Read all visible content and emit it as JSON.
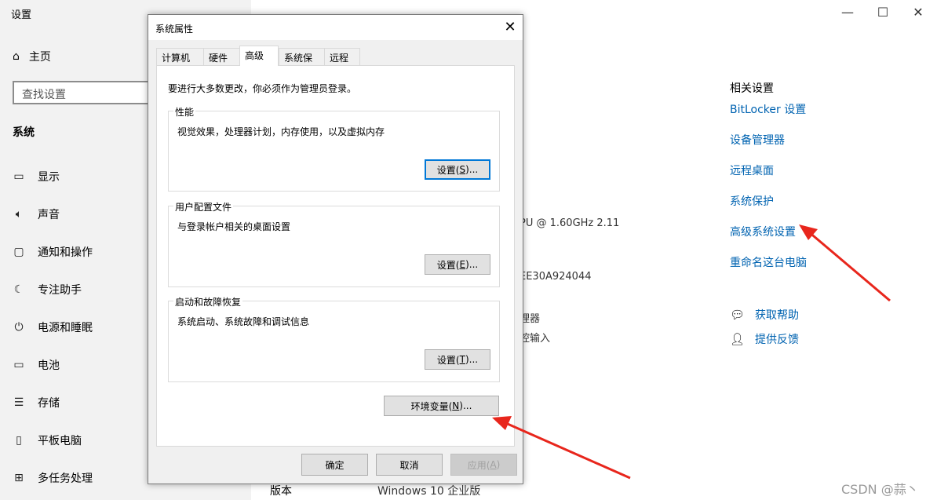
{
  "settings": {
    "window_title": "设置",
    "home_label": "主页",
    "search_placeholder": "查找设置",
    "section_title": "系统",
    "nav_items": [
      {
        "icon": "monitor-icon",
        "label": "显示"
      },
      {
        "icon": "speaker-icon",
        "label": "声音"
      },
      {
        "icon": "notification-icon",
        "label": "通知和操作"
      },
      {
        "icon": "moon-icon",
        "label": "专注助手"
      },
      {
        "icon": "power-icon",
        "label": "电源和睡眠"
      },
      {
        "icon": "battery-icon",
        "label": "电池"
      },
      {
        "icon": "storage-icon",
        "label": "存储"
      },
      {
        "icon": "tablet-icon",
        "label": "平板电脑"
      },
      {
        "icon": "multitask-icon",
        "label": "多任务处理"
      }
    ],
    "window_controls": {
      "minimize": "—",
      "maximize": "☐",
      "close": "✕"
    }
  },
  "background_info": {
    "cpu_partial": "PU @ 1.60GHz   2.11",
    "id_partial": "EE30A924044",
    "processor_partial": "理器",
    "input_partial": "控输入",
    "version_label": "版本",
    "version_value": "Windows 10 企业版"
  },
  "related": {
    "title": "相关设置",
    "links": [
      "BitLocker 设置",
      "设备管理器",
      "远程桌面",
      "系统保护",
      "高级系统设置",
      "重命名这台电脑"
    ],
    "help": [
      {
        "icon": "help-chat-icon",
        "label": "获取帮助"
      },
      {
        "icon": "feedback-icon",
        "label": "提供反馈"
      }
    ]
  },
  "dialog": {
    "title": "系统属性",
    "close": "✕",
    "tabs": [
      "计算机名",
      "硬件",
      "高级",
      "系统保护",
      "远程"
    ],
    "active_tab": "高级",
    "notice": "要进行大多数更改，你必须作为管理员登录。",
    "groups": [
      {
        "label": "性能",
        "desc": "视觉效果，处理器计划，内存使用，以及虚拟内存",
        "button_pre": "设置(",
        "button_key": "S",
        "button_post": ")..."
      },
      {
        "label": "用户配置文件",
        "desc": "与登录帐户相关的桌面设置",
        "button_pre": "设置(",
        "button_key": "E",
        "button_post": ")..."
      },
      {
        "label": "启动和故障恢复",
        "desc": "系统启动、系统故障和调试信息",
        "button_pre": "设置(",
        "button_key": "T",
        "button_post": ")..."
      }
    ],
    "env_button": {
      "pre": "环境变量(",
      "key": "N",
      "post": ")..."
    },
    "ok": "确定",
    "cancel": "取消",
    "apply": {
      "pre": "应用(",
      "key": "A",
      "post": ")"
    }
  },
  "annotation_color": "#e8261c",
  "watermark": "CSDN @蒜丶"
}
